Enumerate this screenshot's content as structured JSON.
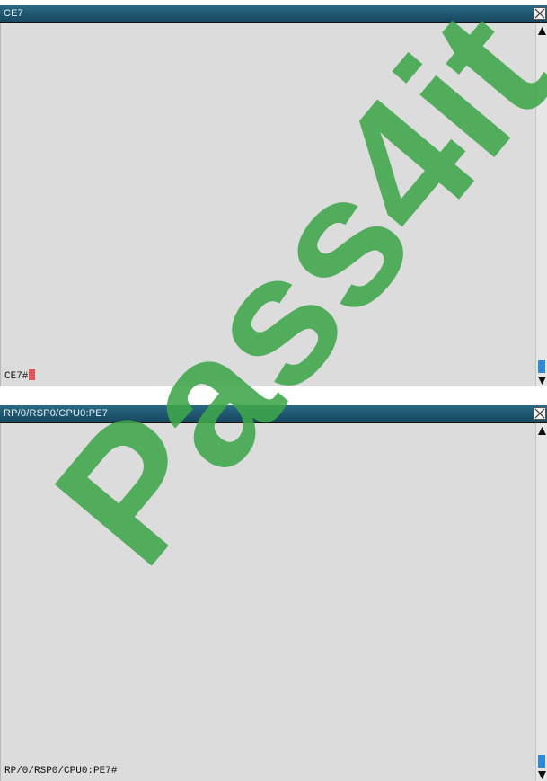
{
  "windows": [
    {
      "title": "CE7",
      "prompt": "CE7#"
    },
    {
      "title": "RP/0/RSP0/CPU0:PE7",
      "prompt": "RP/0/RSP0/CPU0:PE7#"
    }
  ],
  "watermark": {
    "text": "Pass4it",
    "color": "#3ea64a"
  },
  "colors": {
    "titlebar": "#1f5670",
    "terminal_bg": "#dcdcdc",
    "cursor": "#e05555",
    "scroll_thumb": "#2a8bd8"
  },
  "icons": [
    "close-icon",
    "scroll-up-arrow-icon",
    "scroll-down-arrow-icon"
  ]
}
